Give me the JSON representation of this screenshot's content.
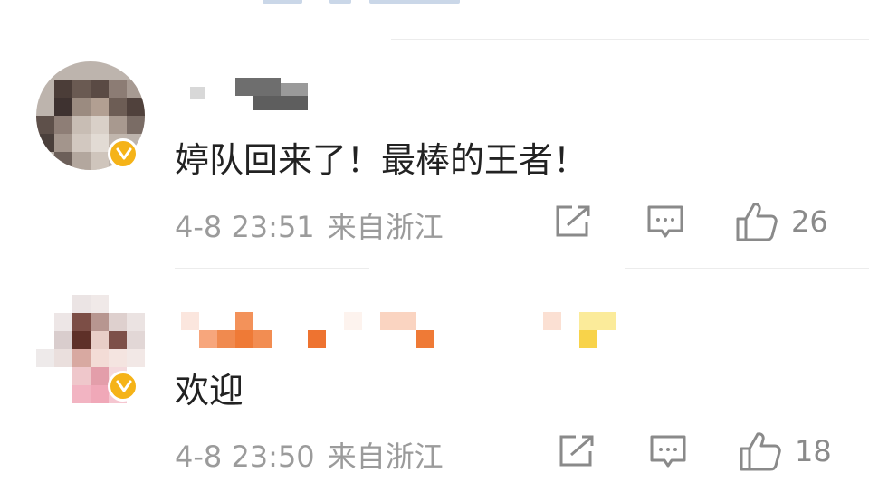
{
  "comments": [
    {
      "text": "婷队回来了！最棒的王者！",
      "date": "4-8 23:51",
      "location": "来自浙江",
      "likes": "26",
      "verified_color": "#f5b318"
    },
    {
      "text": "欢迎",
      "date": "4-8 23:50",
      "location": "来自浙江",
      "likes": "18",
      "verified_color": "#f5b318"
    }
  ],
  "icons": {
    "share": "share-icon",
    "comment": "comment-icon",
    "like": "like-icon",
    "verified": "verified-badge-icon"
  }
}
